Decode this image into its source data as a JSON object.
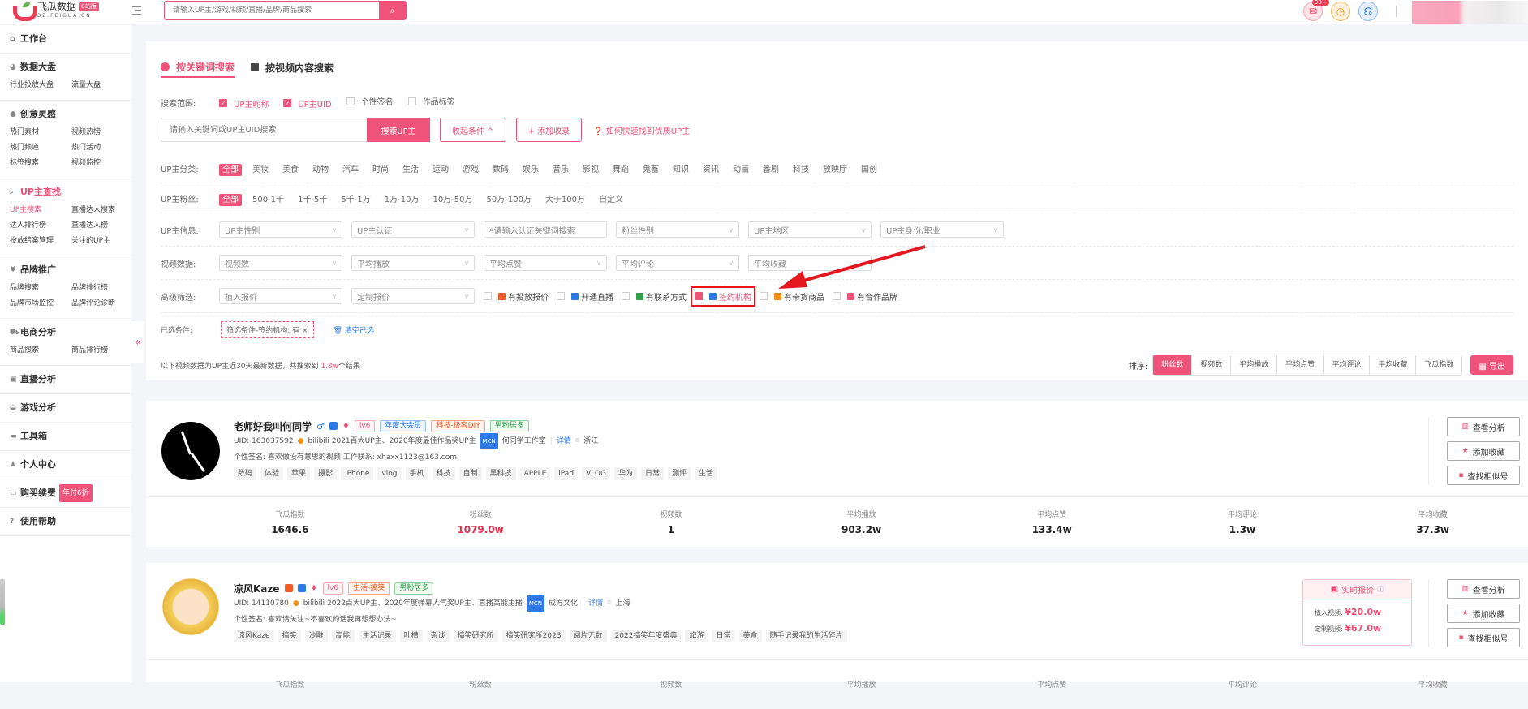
{
  "brand": {
    "name": "飞瓜数据",
    "badge": "B站版",
    "domain": "BZ.FEIGUA.CN"
  },
  "top_search": {
    "placeholder": "请输入UP主/游戏/视频/直播/品牌/商品搜索"
  },
  "notifications": {
    "badge": "99+"
  },
  "sidebar": {
    "sections": [
      {
        "title": "工作台",
        "icon": "home-icon",
        "links": []
      },
      {
        "title": "数据大盘",
        "icon": "pie-chart-icon",
        "links": [
          "行业投放大盘",
          "流量大盘"
        ]
      },
      {
        "title": "创意灵感",
        "icon": "lightbulb-icon",
        "links": [
          "热门素材",
          "视频热榜",
          "热门频道",
          "热门活动",
          "标签搜索",
          "视频监控"
        ]
      },
      {
        "title": "UP主查找",
        "icon": "search-icon",
        "active": true,
        "links": [
          "UP主搜索",
          "直播达人搜索",
          "达人排行榜",
          "直播达人榜",
          "投放结案管理",
          "关注的UP主"
        ]
      },
      {
        "title": "品牌推广",
        "icon": "heart-icon",
        "links": [
          "品牌搜索",
          "品牌排行榜",
          "品牌市场监控",
          "品牌评论诊断"
        ]
      },
      {
        "title": "电商分析",
        "icon": "cart-icon",
        "links": [
          "商品搜索",
          "商品排行榜"
        ]
      },
      {
        "title": "直播分析",
        "icon": "tv-icon",
        "links": []
      },
      {
        "title": "游戏分析",
        "icon": "gamepad-icon",
        "links": []
      },
      {
        "title": "工具箱",
        "icon": "toolbox-icon",
        "links": []
      },
      {
        "title": "个人中心",
        "icon": "user-icon",
        "links": []
      },
      {
        "title": "购买续费",
        "icon": "card-icon",
        "promo": "年付6折",
        "links": []
      },
      {
        "title": "使用帮助",
        "icon": "help-icon",
        "links": []
      }
    ]
  },
  "tabs": [
    {
      "label": "按关键词搜索",
      "active": true
    },
    {
      "label": "按视频内容搜索",
      "active": false
    }
  ],
  "scope": {
    "label": "搜索范围:",
    "options": [
      {
        "label": "UP主昵称",
        "checked": true
      },
      {
        "label": "UP主UID",
        "checked": true
      },
      {
        "label": "个性签名",
        "checked": false
      },
      {
        "label": "作品标签",
        "checked": false
      }
    ]
  },
  "keyword": {
    "placeholder": "请输入关键词或UP主UID搜索",
    "search_btn": "搜索UP主",
    "collapse_btn": "收起条件 ^",
    "add_btn": "+ 添加收录",
    "help": "如何快速找到优质UP主"
  },
  "category": {
    "label": "UP主分类:",
    "items": [
      "全部",
      "美妆",
      "美食",
      "动物",
      "汽车",
      "时尚",
      "生活",
      "运动",
      "游戏",
      "数码",
      "娱乐",
      "音乐",
      "影视",
      "舞蹈",
      "鬼畜",
      "知识",
      "资讯",
      "动画",
      "番剧",
      "科技",
      "放映厅",
      "国创"
    ],
    "selected": 0
  },
  "fans": {
    "label": "UP主粉丝:",
    "items": [
      "全部",
      "500-1千",
      "1千-5千",
      "5千-1万",
      "1万-10万",
      "10万-50万",
      "50万-100万",
      "大于100万",
      "自定义"
    ],
    "selected": 0
  },
  "info_filters": {
    "label": "UP主信息:",
    "selects": [
      "UP主性别",
      "UP主认证",
      "请输入认证关键词搜索",
      "粉丝性别",
      "UP主地区",
      "UP主身份/职业"
    ]
  },
  "video_filters": {
    "label": "视频数据:",
    "selects": [
      "视频数",
      "平均播放",
      "平均点赞",
      "平均评论",
      "平均收藏"
    ]
  },
  "advanced": {
    "label": "高级筛选:",
    "selects": [
      "植入报价",
      "定制报价"
    ],
    "checks": [
      {
        "label": "有投放报价",
        "checked": false,
        "color": "#f05b2a"
      },
      {
        "label": "开通直播",
        "checked": false,
        "color": "#2d7ae6"
      },
      {
        "label": "有联系方式",
        "checked": false,
        "color": "#2ea04a"
      },
      {
        "label": "签约机构",
        "checked": true,
        "color": "#2d7ae6"
      },
      {
        "label": "有带货商品",
        "checked": false,
        "color": "#f29215"
      },
      {
        "label": "有合作品牌",
        "checked": false,
        "color": "#f0537a"
      }
    ]
  },
  "conditions": {
    "label": "已选条件:",
    "tags": [
      "筛选条件-签约机构: 有"
    ],
    "clear": "清空已选"
  },
  "results": {
    "prefix": "以下视频数据为UP主近30天最新数据，共搜索到 ",
    "count": "1.8w",
    "suffix": "个结果"
  },
  "sort": {
    "label": "排序:",
    "options": [
      "粉丝数",
      "视频数",
      "平均播放",
      "平均点赞",
      "平均评论",
      "平均收藏",
      "飞瓜指数"
    ],
    "selected": 0,
    "export": "导出"
  },
  "stat_labels": [
    "飞瓜指数",
    "粉丝数",
    "视频数",
    "平均播放",
    "平均点赞",
    "平均评论",
    "平均收藏"
  ],
  "actions": [
    "查看分析",
    "添加收藏",
    "查找相似号"
  ],
  "creators": [
    {
      "name": "老师好我叫何同学",
      "tags": [
        "lv6",
        "年度大会员",
        "科技-极客DIY",
        "男粉居多"
      ],
      "uid": "UID: 163637592",
      "honor": "bilibili 2021百大UP主、2020年度最佳作品奖UP主",
      "mcn": "何同学工作室",
      "detail": "详情",
      "region": "浙江",
      "signature": "个性签名: 喜欢做没有意思的视频 工作联系: xhaxx1123@163.com",
      "keywords": [
        "数码",
        "体验",
        "苹果",
        "摄影",
        "iPhone",
        "vlog",
        "手机",
        "科技",
        "自制",
        "黑科技",
        "APPLE",
        "iPad",
        "VLOG",
        "华为",
        "日常",
        "测评",
        "生活"
      ],
      "stats": [
        "1646.6",
        "1079.0w",
        "1",
        "903.2w",
        "133.4w",
        "1.3w",
        "37.3w"
      ]
    },
    {
      "name": "凉风Kaze",
      "tags": [
        "lv6",
        "生活-搞笑",
        "男粉居多"
      ],
      "uid": "UID: 14110780",
      "honor": "bilibili 2022百大UP主、2020年度弹幕人气奖UP主、直播高能主播",
      "mcn": "成方文化",
      "detail": "详情",
      "region": "上海",
      "signature": "个性签名: 喜欢请关注~不喜欢的话我再想想办法~",
      "keywords": [
        "凉风Kaze",
        "搞笑",
        "沙雕",
        "高能",
        "生活记录",
        "吐槽",
        "杂谈",
        "搞笑研究所",
        "搞笑研究所2023",
        "阅片无数",
        "2022搞笑年度盛典",
        "旅游",
        "日常",
        "美食",
        "随手记录我的生活碎片"
      ],
      "quote": {
        "title": "实时报价",
        "embed_label": "植入视频: ",
        "embed_value": "¥20.0w",
        "custom_label": "定制视频: ",
        "custom_value": "¥67.0w"
      }
    }
  ]
}
